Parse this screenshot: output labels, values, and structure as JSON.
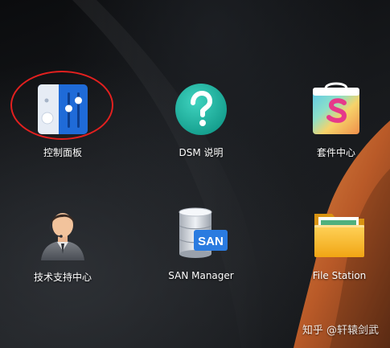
{
  "desktop": {
    "apps": [
      {
        "id": "control-panel",
        "label": "控制面板"
      },
      {
        "id": "dsm-help",
        "label": "DSM 说明"
      },
      {
        "id": "package-center",
        "label": "套件中心"
      },
      {
        "id": "support-center",
        "label": "技术支持中心"
      },
      {
        "id": "san-manager",
        "label": "SAN Manager",
        "icon_text": "SAN"
      },
      {
        "id": "file-station",
        "label": "File Station"
      }
    ],
    "watermark": "知乎 @轩辕剑武",
    "colors": {
      "highlight": "#e3201f",
      "control_panel_blue": "#1f6bd8",
      "help_teal": "#1fb5a3",
      "san_blue": "#2a7be0",
      "folder_yellow": "#f5b21c",
      "wallpaper_orange": "#c8682f"
    }
  }
}
